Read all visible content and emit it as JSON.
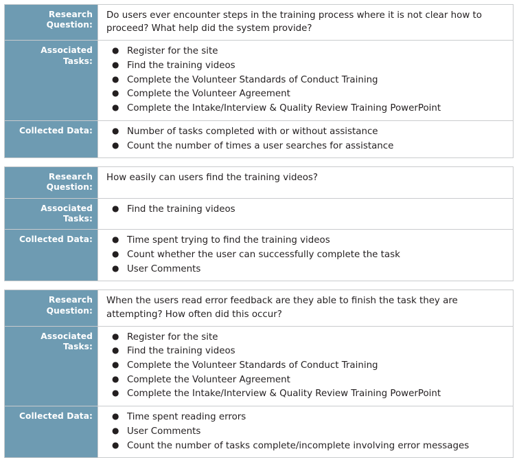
{
  "colors": {
    "label_background": "#6e9bb2",
    "label_text": "#ffffff",
    "border": "#c9cbcd",
    "content_background": "#ffffff",
    "body_text": "#231f20"
  },
  "labels": {
    "research_question": "Research Question:",
    "associated_tasks": "Associated Tasks:",
    "collected_data": "Collected Data:"
  },
  "bullet_glyph": "●",
  "tables": [
    {
      "research_question": "Do users ever encounter steps in the training process where it is not clear how to proceed? What help did the system provide?",
      "associated_tasks": [
        "Register for the site",
        "Find the training videos",
        "Complete the Volunteer Standards of Conduct Training",
        "Complete the Volunteer Agreement",
        "Complete the Intake/Interview & Quality Review Training PowerPoint"
      ],
      "collected_data": [
        "Number of tasks completed with or without assistance",
        "Count the number of times a user searches for assistance"
      ]
    },
    {
      "research_question": "How easily can users find the training videos?",
      "associated_tasks": [
        "Find the training videos"
      ],
      "collected_data": [
        "Time spent trying to find the training videos",
        "Count whether the user can successfully complete the task",
        "User Comments"
      ]
    },
    {
      "research_question": "When the users read error feedback are they able to finish the task they are attempting? How often did this occur?",
      "associated_tasks": [
        "Register for the site",
        "Find the training videos",
        "Complete the Volunteer Standards of Conduct Training",
        "Complete the Volunteer Agreement",
        "Complete the Intake/Interview & Quality Review Training PowerPoint"
      ],
      "collected_data": [
        "Time spent reading errors",
        "User Comments",
        "Count the number of tasks complete/incomplete involving error messages"
      ]
    }
  ]
}
